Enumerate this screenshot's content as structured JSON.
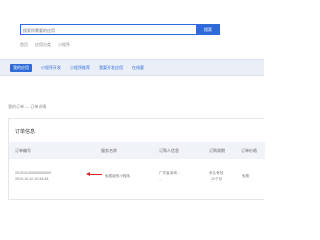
{
  "search": {
    "placeholder": "搜索你需要的应用",
    "button_label": "搜索"
  },
  "hotwords": [
    "首页",
    "应用分类",
    "小程序"
  ],
  "nav": {
    "items": [
      {
        "label": "我的应用",
        "active": true
      },
      {
        "label": "小程序开发",
        "active": false
      },
      {
        "label": "小程序推荐",
        "active": false
      },
      {
        "label": "我要开发应用",
        "active": false
      },
      {
        "label": "在线客",
        "active": false
      }
    ]
  },
  "breadcrumb": "我的订单 — 订单详情",
  "panel": {
    "title": "订单信息",
    "columns": [
      "订单编号",
      "服务名称",
      "订购人信息",
      "订购周期",
      "订单价格"
    ],
    "rows": [
      {
        "order_number": "201910100000000000",
        "order_time": "2019-10-10 10:44:48",
        "service_name": "免费版的小程序",
        "buyer_line1": "广东省深圳...",
        "buyer_line2": "...",
        "period_line1": "永久有效",
        "period_line2": "12个月",
        "price": "免费"
      }
    ]
  },
  "colors": {
    "accent": "#2f6bd8",
    "nav_bg": "#e9eef7",
    "annotation_arrow": "#d9262b"
  }
}
